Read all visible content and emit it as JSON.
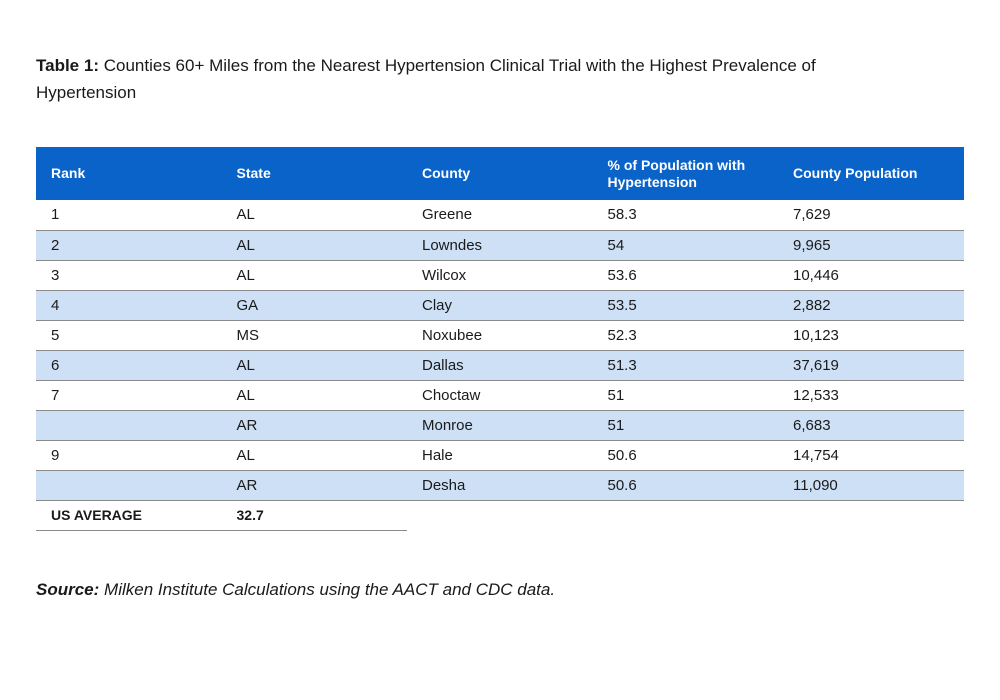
{
  "caption": {
    "label": "Table 1:",
    "text": "Counties 60+ Miles from the Nearest Hypertension Clinical Trial with the Highest Prevalence of Hypertension"
  },
  "table": {
    "header_color": "#0a63c9",
    "stripe_color": "#cde0f5",
    "headers": [
      "Rank",
      "State",
      "County",
      "% of Population with Hypertension",
      "County Population"
    ],
    "rows": [
      [
        "1",
        "AL",
        "Greene",
        "58.3",
        "7,629"
      ],
      [
        "2",
        "AL",
        "Lowndes",
        "54",
        "9,965"
      ],
      [
        "3",
        "AL",
        "Wilcox",
        "53.6",
        "10,446"
      ],
      [
        "4",
        "GA",
        "Clay",
        "53.5",
        "2,882"
      ],
      [
        "5",
        "MS",
        "Noxubee",
        "52.3",
        "10,123"
      ],
      [
        "6",
        "AL",
        "Dallas",
        "51.3",
        "37,619"
      ],
      [
        "7",
        "AL",
        "Choctaw",
        "51",
        "12,533"
      ],
      [
        "",
        "AR",
        "Monroe",
        "51",
        "6,683"
      ],
      [
        "9",
        "AL",
        "Hale",
        "50.6",
        "14,754"
      ],
      [
        "",
        "AR",
        "Desha",
        "50.6",
        "11,090"
      ]
    ],
    "us_average": {
      "label": "US AVERAGE",
      "value": "32.7"
    }
  },
  "source": {
    "label": "Source:",
    "text": "Milken Institute Calculations using the AACT and CDC data."
  }
}
